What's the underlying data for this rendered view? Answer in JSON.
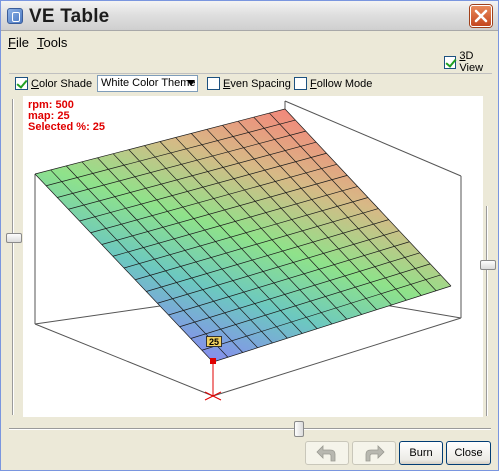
{
  "window": {
    "title": "VE Table",
    "title_icon": "app-icon",
    "close_icon": "close-icon"
  },
  "menu": {
    "items": [
      "File",
      "Tools"
    ]
  },
  "view3d": {
    "label": "3D View",
    "checked": true
  },
  "toolbar": {
    "color_shade": {
      "label": "Color Shade",
      "checked": true
    },
    "theme": {
      "selected": "White Color Theme"
    },
    "even_spacing": {
      "label": "Even Spacing",
      "checked": false
    },
    "follow_mode": {
      "label": "Follow Mode",
      "checked": false
    }
  },
  "plot": {
    "rpm_line": "rpm: 500",
    "map_line": "map: 25",
    "selected_line": "Selected %: 25",
    "marker_label": "25",
    "colors": {
      "high": "#f08c80",
      "mid": "#80e880",
      "low": "#8080f0",
      "cursor": "#e00000"
    }
  },
  "buttons": {
    "undo_icon": "undo-icon",
    "redo_icon": "redo-icon",
    "burn": "Burn",
    "close": "Close"
  }
}
